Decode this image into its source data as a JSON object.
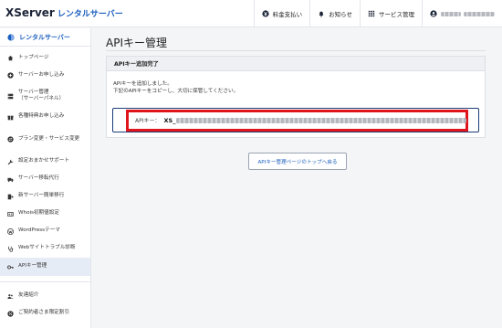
{
  "header": {
    "logo_main": "XServer",
    "logo_sub": "レンタルサーバー",
    "nav": [
      {
        "label": "料金支払い",
        "icon": "yen-icon"
      },
      {
        "label": "お知らせ",
        "icon": "bell-icon"
      },
      {
        "label": "サービス管理",
        "icon": "grid-icon"
      }
    ],
    "user_icon": "user-icon"
  },
  "sidebar": {
    "title": "レンタルサーバー",
    "items": [
      {
        "label": "トップページ",
        "icon": "home-icon"
      },
      {
        "label": "サーバーお申し込み",
        "icon": "plus-circle-icon"
      },
      {
        "label": "サーバー管理",
        "sublabel": "（サーバーパネル）",
        "icon": "server-icon"
      },
      {
        "label": "各種特典お申し込み",
        "icon": "gift-icon"
      },
      {
        "label": "プラン変更・サービス変更",
        "icon": "swap-icon"
      },
      {
        "label": "設定おまかせサポート",
        "icon": "wrench-icon"
      },
      {
        "label": "サーバー移転代行",
        "icon": "truck-icon"
      },
      {
        "label": "新サーバー簡単移行",
        "icon": "migrate-icon"
      },
      {
        "label": "Whois初期値設定",
        "icon": "id-card-icon"
      },
      {
        "label": "WordPressテーマ",
        "icon": "wordpress-icon"
      },
      {
        "label": "Webサイトトラブル診断",
        "icon": "stethoscope-icon"
      },
      {
        "label": "APIキー管理",
        "icon": "key-icon"
      },
      {
        "label": "友達紹介",
        "icon": "friends-icon"
      },
      {
        "label": "ご契約者さま限定割引",
        "icon": "percent-icon"
      }
    ]
  },
  "main": {
    "title": "APIキー管理",
    "card_title": "APIキー追加完了",
    "message_1": "APIキーを追加しました。",
    "message_2": "下記のAPIキーをコピーし、大切に保管してください。",
    "key_label": "APIキー：",
    "key_prefix": "XS_",
    "back_button": "APIキー管理ページのトップへ戻る"
  },
  "colors": {
    "accent_blue": "#1b5fbe",
    "highlight_red": "#e0151c",
    "active_row": "#e6ecf6"
  }
}
